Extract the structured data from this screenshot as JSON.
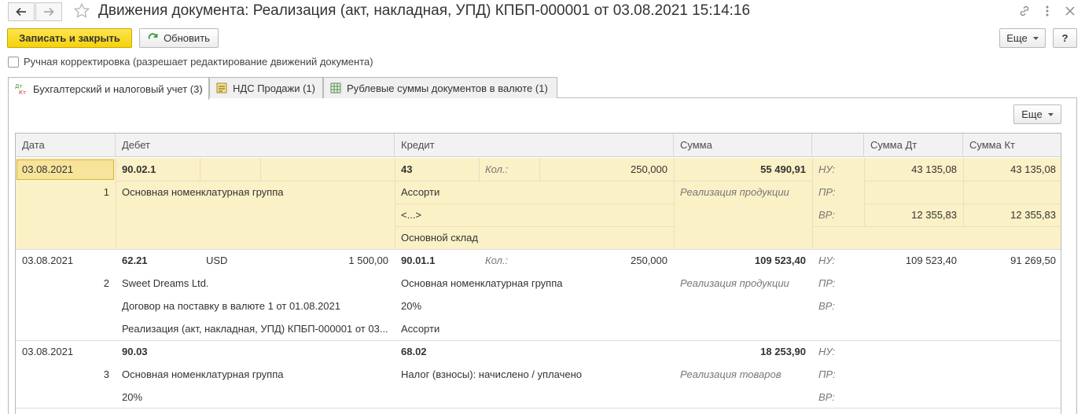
{
  "window": {
    "title": "Движения документа: Реализация (акт, накладная, УПД) КПБП-000001 от 03.08.2021 15:14:16",
    "back_icon": "arrow-left-icon",
    "forward_icon": "arrow-right-icon",
    "favorite_icon": "star-icon",
    "link_icon": "link-icon",
    "more_icon": "vertical-dots-icon",
    "close_icon": "close-icon"
  },
  "toolbar": {
    "save_close_label": "Записать и закрыть",
    "refresh_label": "Обновить",
    "more_label": "Еще",
    "help_label": "?"
  },
  "manual_edit": {
    "label": "Ручная корректировка (разрешает редактирование движений документа)",
    "checked": false
  },
  "tabs": [
    {
      "label": "Бухгалтерский и налоговый учет (3)",
      "icon": "dt-kt-icon",
      "active": true
    },
    {
      "label": "НДС Продажи (1)",
      "icon": "register-icon",
      "active": false
    },
    {
      "label": "Рублевые суммы документов в валюте (1)",
      "icon": "table-icon",
      "active": false
    }
  ],
  "panel": {
    "more_label": "Еще"
  },
  "table": {
    "headers": {
      "date": "Дата",
      "debit": "Дебет",
      "credit": "Кредит",
      "sum": "Сумма",
      "blank": "",
      "sum_dt": "Сумма Дт",
      "sum_kt": "Сумма Кт"
    },
    "rows": [
      {
        "date": "03.08.2021",
        "num": "1",
        "debit_account": "90.02.1",
        "debit_currency": "",
        "debit_currency_amount": "",
        "debit_sub": [
          "Основная номенклатурная группа",
          "",
          ""
        ],
        "credit_account": "43",
        "credit_qty_label": "Кол.:",
        "credit_qty": "250,000",
        "credit_sub": [
          "Ассорти",
          "<...>",
          "Основной склад"
        ],
        "sum": "55 490,91",
        "content": "Реализация продукции",
        "tax_labels": [
          "НУ:",
          "ПР:",
          "ВР:"
        ],
        "sum_dt": [
          "43 135,08",
          "",
          "12 355,83"
        ],
        "sum_kt": [
          "43 135,08",
          "",
          "12 355,83"
        ],
        "selected": true
      },
      {
        "date": "03.08.2021",
        "num": "2",
        "debit_account": "62.21",
        "debit_currency": "USD",
        "debit_currency_amount": "1 500,00",
        "debit_sub": [
          "Sweet Dreams Ltd.",
          "Договор на поставку в валюте 1 от 01.08.2021",
          "Реализация (акт, накладная, УПД) КПБП-000001 от 03..."
        ],
        "credit_account": "90.01.1",
        "credit_qty_label": "Кол.:",
        "credit_qty": "250,000",
        "credit_sub": [
          "Основная номенклатурная группа",
          "20%",
          "Ассорти"
        ],
        "sum": "109 523,40",
        "content": "Реализация продукции",
        "tax_labels": [
          "НУ:",
          "ПР:",
          "ВР:"
        ],
        "sum_dt": [
          "109 523,40",
          "",
          ""
        ],
        "sum_kt": [
          "91 269,50",
          "",
          ""
        ],
        "selected": false
      },
      {
        "date": "03.08.2021",
        "num": "3",
        "debit_account": "90.03",
        "debit_currency": "",
        "debit_currency_amount": "",
        "debit_sub": [
          "Основная номенклатурная группа",
          "20%",
          ""
        ],
        "credit_account": "68.02",
        "credit_qty_label": "",
        "credit_qty": "",
        "credit_sub": [
          "Налог (взносы): начислено / уплачено",
          "",
          ""
        ],
        "sum": "18 253,90",
        "content": "Реализация товаров",
        "tax_labels": [
          "НУ:",
          "ПР:",
          "ВР:"
        ],
        "sum_dt": [
          "",
          "",
          ""
        ],
        "sum_kt": [
          "",
          "",
          ""
        ],
        "selected": false
      }
    ]
  }
}
